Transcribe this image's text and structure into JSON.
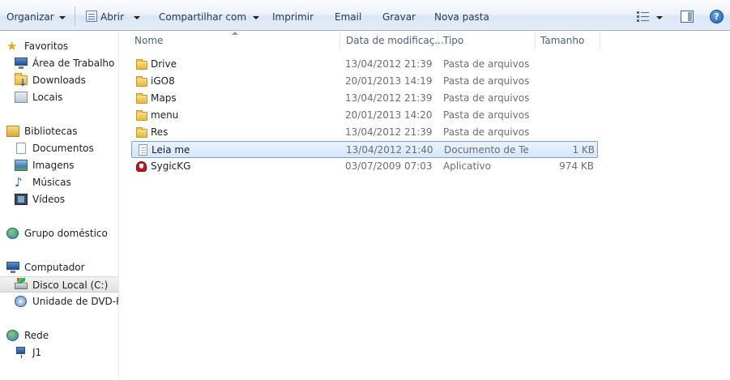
{
  "toolbar": {
    "organize": "Organizar",
    "open": "Abrir",
    "share": "Compartilhar com",
    "print": "Imprimir",
    "email": "Email",
    "burn": "Gravar",
    "new_folder": "Nova pasta",
    "help_glyph": "?"
  },
  "sidebar": {
    "favorites": {
      "label": "Favoritos",
      "items": [
        {
          "label": "Área de Trabalho",
          "icon": "desktop-icon"
        },
        {
          "label": "Downloads",
          "icon": "downloads-icon"
        },
        {
          "label": "Locais",
          "icon": "recent-places-icon"
        }
      ]
    },
    "libraries": {
      "label": "Bibliotecas",
      "items": [
        {
          "label": "Documentos",
          "icon": "documents-icon"
        },
        {
          "label": "Imagens",
          "icon": "pictures-icon"
        },
        {
          "label": "Músicas",
          "icon": "music-icon"
        },
        {
          "label": "Vídeos",
          "icon": "videos-icon"
        }
      ]
    },
    "homegroup": {
      "label": "Grupo doméstico"
    },
    "computer": {
      "label": "Computador",
      "items": [
        {
          "label": "Disco Local (C:)",
          "icon": "local-disk-icon",
          "selected": true
        },
        {
          "label": "Unidade de DVD-RW",
          "icon": "dvd-drive-icon"
        }
      ]
    },
    "network": {
      "label": "Rede",
      "items": [
        {
          "label": "J1",
          "icon": "network-computer-icon"
        }
      ]
    }
  },
  "columns": {
    "name": "Nome",
    "date": "Data de modificaç...",
    "type": "Tipo",
    "size": "Tamanho"
  },
  "files": [
    {
      "name": "Drive",
      "date": "13/04/2012 21:39",
      "type": "Pasta de arquivos",
      "size": "",
      "icon": "folder-icon"
    },
    {
      "name": "iGO8",
      "date": "20/01/2013 14:19",
      "type": "Pasta de arquivos",
      "size": "",
      "icon": "folder-icon"
    },
    {
      "name": "Maps",
      "date": "13/04/2012 21:39",
      "type": "Pasta de arquivos",
      "size": "",
      "icon": "folder-icon"
    },
    {
      "name": "menu",
      "date": "20/01/2013 14:20",
      "type": "Pasta de arquivos",
      "size": "",
      "icon": "folder-icon"
    },
    {
      "name": "Res",
      "date": "13/04/2012 21:39",
      "type": "Pasta de arquivos",
      "size": "",
      "icon": "folder-icon"
    },
    {
      "name": "Leia me",
      "date": "13/04/2012 21:40",
      "type": "Documento de Te...",
      "size": "1 KB",
      "icon": "text-document-icon",
      "selected": true
    },
    {
      "name": "SygicKG",
      "date": "03/07/2009 07:03",
      "type": "Aplicativo",
      "size": "974 KB",
      "icon": "application-icon"
    }
  ]
}
